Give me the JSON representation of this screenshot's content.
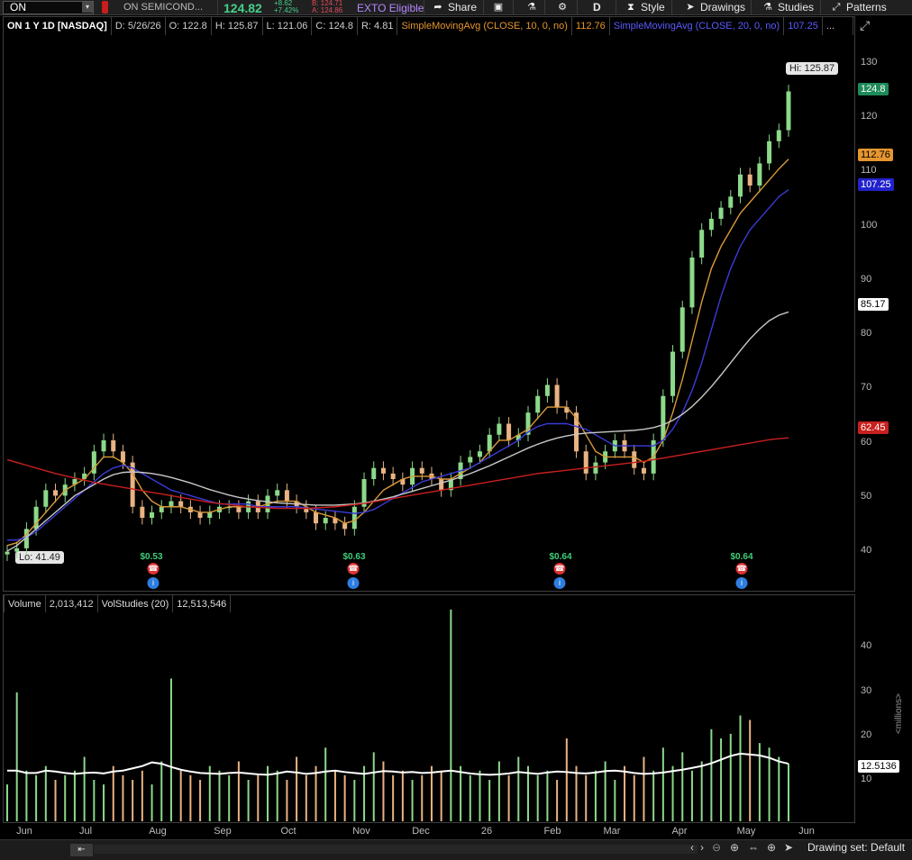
{
  "toolbar": {
    "symbol": "ON",
    "company": "ON SEMICOND...",
    "last_price": "124.82",
    "change": "+8.62",
    "change_pct": "+7.42%",
    "bid": "B: 124.71",
    "ask": "A: 124.86",
    "exto": "EXTO Eligible",
    "share": "Share",
    "period": "D",
    "style": "Style",
    "drawings": "Drawings",
    "studies": "Studies",
    "patterns": "Patterns",
    "icons": [
      "menu-down-icon",
      "flag-icon",
      "share-icon",
      "chat-icon",
      "flask-icon",
      "gear-icon",
      "style-icon",
      "cursor-icon",
      "studies-icon",
      "patterns-icon"
    ]
  },
  "infobar": {
    "title": "ON 1 Y 1D [NASDAQ]",
    "date": "D: 5/26/26",
    "open": "O: 122.8",
    "high": "H: 125.87",
    "low": "L: 121.06",
    "close": "C: 124.8",
    "range": "R: 4.81",
    "sma10_label": "SimpleMovingAvg (CLOSE, 10, 0, no)",
    "sma10_value": "112.76",
    "sma20_label": "SimpleMovingAvg (CLOSE, 20, 0, no)",
    "sma20_value": "107.25",
    "more": "..."
  },
  "volbar": {
    "title": "Volume",
    "value": "2,013,412",
    "study_label": "VolStudies (20)",
    "study_value": "12,513,546"
  },
  "price_axis": {
    "ticks": [
      "130",
      "120",
      "110",
      "100",
      "90",
      "80",
      "70",
      "60",
      "50",
      "40"
    ],
    "labels": {
      "last": "124.8",
      "sma10": "112.76",
      "sma20": "107.25",
      "sma_gray": "85.17",
      "sma_red": "62.45"
    }
  },
  "volume_axis": {
    "ticks": [
      "40",
      "30",
      "20",
      "10"
    ],
    "last_label": "12.5136",
    "unit": "<millions>"
  },
  "x_axis": [
    "Jun",
    "Jul",
    "Aug",
    "Sep",
    "Oct",
    "Nov",
    "Dec",
    "26",
    "Feb",
    "Mar",
    "Apr",
    "May",
    "Jun"
  ],
  "annotations": {
    "hi": "Hi: 125.87",
    "lo": "Lo: 41.49",
    "dividends": [
      "$0.53",
      "$0.63",
      "$0.64",
      "$0.64"
    ]
  },
  "bottom": {
    "drawing_set": "Drawing set: Default"
  },
  "colors": {
    "up": "#8cd98a",
    "down": "#e9b383",
    "sma10": "#d99a3a",
    "sma20": "#3b3bd8",
    "sma_gray": "#c8c8c8",
    "sma_red": "#c8201e",
    "volume_avg": "#ffffff"
  },
  "chart_data": {
    "type": "line",
    "title": "ON 1 Y 1D [NASDAQ]",
    "ylim": [
      35,
      135
    ],
    "volume_ylim": [
      0,
      45
    ],
    "months": [
      "Jun",
      "Jul",
      "Aug",
      "Sep",
      "Oct",
      "Nov",
      "Dec",
      "26",
      "Feb",
      "Mar",
      "Apr",
      "May",
      "Jun"
    ],
    "series": [
      {
        "name": "Close",
        "values": [
          41.9,
          42.5,
          46,
          50,
          53,
          52,
          54,
          55,
          56,
          60,
          62,
          60,
          58,
          50,
          48,
          49,
          50,
          51,
          50,
          49,
          48,
          49,
          50,
          50,
          49,
          51,
          49,
          52,
          53,
          51,
          50,
          49,
          47,
          48,
          47,
          46,
          50,
          55,
          57,
          56,
          55,
          54,
          57,
          56,
          55,
          53,
          55,
          58,
          59,
          60,
          63,
          65,
          62,
          63,
          67,
          70,
          72,
          68,
          67,
          60,
          56,
          58,
          60,
          62,
          60,
          57,
          56,
          62,
          70,
          78,
          86,
          95,
          100,
          102,
          104,
          106,
          110,
          108,
          112,
          116,
          118,
          125
        ]
      },
      {
        "name": "SimpleMovingAvg (CLOSE, 10, 0, no)",
        "values": [
          43,
          43.5,
          45,
          47,
          49,
          51,
          53,
          54,
          55,
          57,
          59,
          59,
          58,
          56,
          53,
          51,
          50,
          50,
          50,
          49.5,
          49,
          49,
          49.5,
          50,
          50,
          50,
          50,
          50.5,
          51,
          51,
          51,
          50,
          49,
          48.5,
          48,
          47,
          47.5,
          49,
          51,
          53,
          54,
          55,
          55.5,
          55.5,
          55.5,
          55,
          55,
          56,
          57,
          58,
          60,
          62,
          62,
          63,
          64,
          66,
          68,
          68,
          68,
          66,
          63,
          60,
          59,
          59,
          59,
          59,
          58,
          59,
          62,
          67,
          73,
          80,
          87,
          93,
          97,
          100,
          103,
          105,
          107,
          109,
          111,
          112.76
        ]
      },
      {
        "name": "SimpleMovingAvg (CLOSE, 20, 0, no)",
        "values": [
          44,
          44,
          44.5,
          45.5,
          47,
          48.5,
          50,
          51.5,
          53,
          54.5,
          56,
          57,
          57.5,
          57,
          56,
          55,
          54,
          53,
          52.5,
          52,
          51.5,
          51,
          50.5,
          50.5,
          50.5,
          50.5,
          50,
          50,
          50,
          50,
          50,
          49.8,
          49.6,
          49.4,
          49.2,
          49,
          48.8,
          49,
          49.5,
          50.5,
          51.5,
          52.5,
          53.5,
          54.5,
          55,
          55.5,
          56,
          56.5,
          57,
          58,
          59,
          60,
          61,
          62,
          63.5,
          64.5,
          65,
          65,
          65,
          64.5,
          64,
          63,
          62,
          61,
          61,
          61,
          61,
          61,
          62,
          64,
          67,
          71,
          76,
          82,
          88,
          93,
          97,
          100,
          102,
          104,
          106,
          107.25
        ]
      },
      {
        "name": "SMA long (gray)",
        "values": [
          42,
          43,
          44.5,
          46,
          47.5,
          49,
          50.5,
          52,
          53,
          54,
          55,
          55.8,
          56.2,
          56.3,
          56.2,
          56,
          55.7,
          55.3,
          54.8,
          54.3,
          53.7,
          53.1,
          52.6,
          52.1,
          51.7,
          51.4,
          51.1,
          50.9,
          50.7,
          50.6,
          50.5,
          50.4,
          50.3,
          50.3,
          50.3,
          50.4,
          50.5,
          50.7,
          51,
          51.4,
          51.8,
          52.3,
          52.8,
          53.3,
          53.8,
          54.3,
          54.8,
          55.4,
          56,
          56.7,
          57.4,
          58.2,
          59,
          59.8,
          60.6,
          61.3,
          61.9,
          62.4,
          62.8,
          63.1,
          63.3,
          63.4,
          63.5,
          63.6,
          63.7,
          63.8,
          64,
          64.3,
          64.8,
          65.6,
          66.7,
          68.1,
          69.8,
          71.7,
          73.8,
          76,
          78.2,
          80.3,
          82.1,
          83.6,
          84.6,
          85.17
        ]
      },
      {
        "name": "SMA long (red)",
        "values": [
          58.5,
          58,
          57.5,
          57,
          56.5,
          56,
          55.6,
          55.2,
          54.8,
          54.4,
          54.1,
          53.8,
          53.5,
          53.2,
          52.9,
          52.6,
          52.3,
          52,
          51.7,
          51.4,
          51.1,
          50.8,
          50.6,
          50.4,
          50.2,
          50,
          49.9,
          49.8,
          49.7,
          49.7,
          49.7,
          49.7,
          49.8,
          49.9,
          50,
          50.2,
          50.4,
          50.6,
          50.9,
          51.2,
          51.5,
          51.8,
          52.1,
          52.4,
          52.7,
          53,
          53.3,
          53.6,
          53.9,
          54.2,
          54.5,
          54.8,
          55.1,
          55.4,
          55.7,
          56,
          56.2,
          56.4,
          56.6,
          56.8,
          57,
          57.2,
          57.4,
          57.6,
          57.8,
          58,
          58.2,
          58.5,
          58.8,
          59.1,
          59.4,
          59.7,
          60,
          60.3,
          60.6,
          60.9,
          61.2,
          61.5,
          61.8,
          62.1,
          62.3,
          62.45
        ]
      }
    ],
    "volume_millions": [
      8,
      28,
      11,
      10,
      12,
      9,
      10,
      11,
      14,
      9,
      8,
      12,
      10,
      9,
      11,
      8,
      13,
      31,
      11,
      10,
      9,
      12,
      11,
      10,
      13,
      9,
      10,
      12,
      11,
      9,
      14,
      10,
      12,
      16,
      11,
      10,
      9,
      12,
      15,
      13,
      10,
      11,
      9,
      10,
      12,
      11,
      46,
      12,
      10,
      11,
      9,
      13,
      10,
      14,
      12,
      10,
      11,
      9,
      18,
      12,
      10,
      11,
      13,
      9,
      12,
      10,
      14,
      11,
      16,
      12,
      15,
      11,
      13,
      20,
      18,
      19,
      23,
      22,
      17,
      16,
      14,
      12.5
    ],
    "volume_avg_millions": [
      11,
      11,
      10.5,
      10.5,
      11,
      10.8,
      10.5,
      10.3,
      10.5,
      10.6,
      10.4,
      10.8,
      11,
      11.5,
      12,
      12.8,
      12.5,
      11.8,
      11.2,
      10.8,
      10.5,
      10.4,
      10.3,
      10.5,
      10.6,
      10.4,
      10.2,
      10.1,
      10.4,
      10.8,
      10.6,
      10.3,
      10.5,
      10.8,
      11,
      10.7,
      10.5,
      10.3,
      10.6,
      10.9,
      10.8,
      10.6,
      10.7,
      10.5,
      10.6,
      10.8,
      11,
      10.7,
      10.4,
      10.2,
      10.1,
      10.2,
      10.4,
      10.7,
      10.5,
      10.3,
      10.6,
      10.8,
      10.7,
      10.5,
      10.4,
      10.6,
      10.9,
      11,
      10.8,
      10.5,
      10.3,
      10.4,
      10.6,
      10.9,
      11.2,
      11.6,
      12,
      12.6,
      13.4,
      14.2,
      14.7,
      14.5,
      14.3,
      13.8,
      13,
      12.5136
    ]
  }
}
